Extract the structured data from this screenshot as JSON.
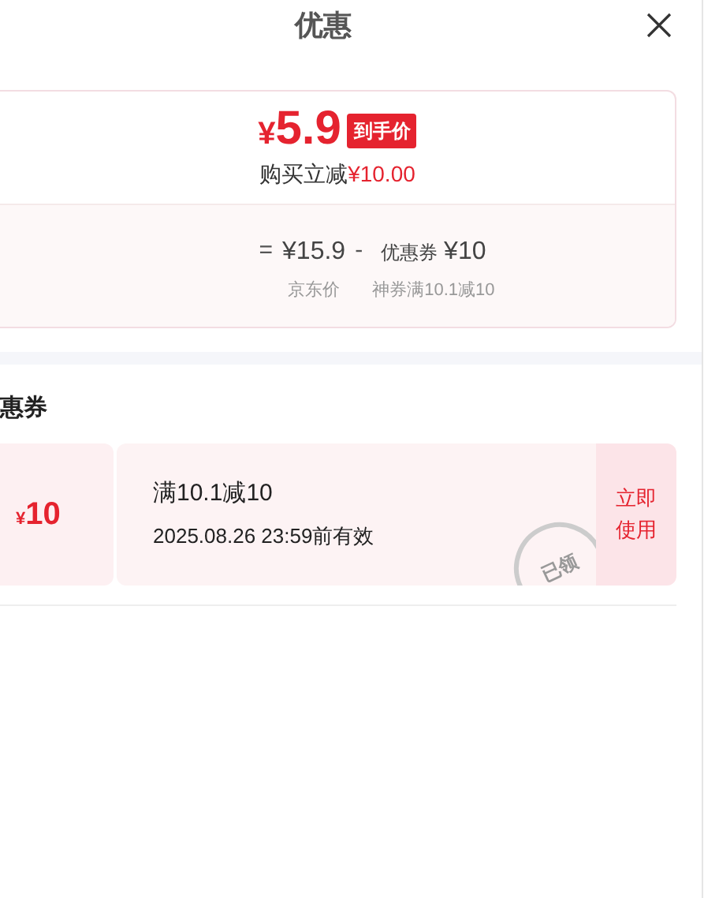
{
  "header": {
    "title": "优惠"
  },
  "summary": {
    "currency": "¥",
    "price": "5.9",
    "badge": "到手价",
    "saving_label": "购买立减",
    "saving_amount": "¥10.00",
    "formula": [
      {
        "kind": "operator",
        "value": "="
      },
      {
        "kind": "amount",
        "value": "¥15.9",
        "caption": "京东价"
      },
      {
        "kind": "operator",
        "value": "-"
      },
      {
        "kind": "coupon",
        "label": "优惠券",
        "value": "¥10",
        "caption": "神券满10.1减10"
      }
    ]
  },
  "section": {
    "title": "惠券"
  },
  "coupons": [
    {
      "currency": "¥",
      "amount": "10",
      "condition": "满10.1减10",
      "validity": "2025.08.26 23:59前有效",
      "stamp": "已领",
      "button": "立即使用"
    }
  ]
}
